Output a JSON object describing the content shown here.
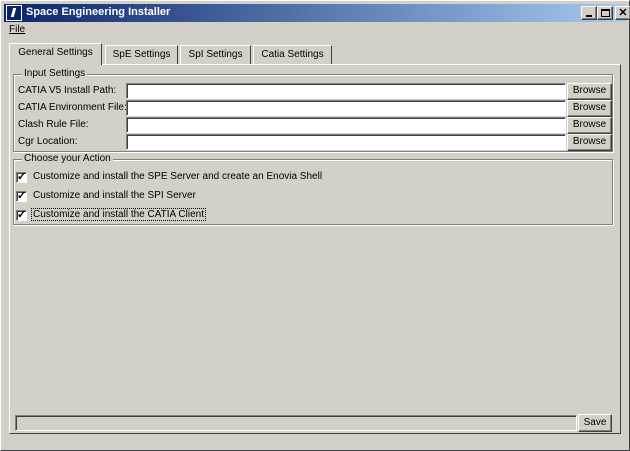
{
  "window": {
    "title": "Space Engineering Installer",
    "controls": {
      "minimize": "_",
      "maximize": "□",
      "close": "✕"
    }
  },
  "menu": {
    "file_label": "File"
  },
  "tabs": [
    {
      "label": "General  Settings",
      "active": true
    },
    {
      "label": "SpE Settings",
      "active": false
    },
    {
      "label": "SpI Settings",
      "active": false
    },
    {
      "label": "Catia Settings",
      "active": false
    }
  ],
  "input_settings": {
    "legend": "Input Settings",
    "fields": [
      {
        "label": "CATIA V5 Install Path:",
        "value": "",
        "button": "Browse"
      },
      {
        "label": "CATIA Environment File:",
        "value": "",
        "button": "Browse"
      },
      {
        "label": "Clash Rule File:",
        "value": "",
        "button": "Browse"
      },
      {
        "label": "Cgr Location:",
        "value": "",
        "button": "Browse"
      }
    ]
  },
  "actions": {
    "legend": "Choose your Action",
    "options": [
      {
        "label": "Customize and install the SPE Server and create an Enovia Shell",
        "checked": true
      },
      {
        "label": "Customize and install the SPI Server",
        "checked": true
      },
      {
        "label": "Customize and install the CATIA Client",
        "checked": true
      }
    ],
    "check_glyph": "✓"
  },
  "footer": {
    "status_text": "",
    "save_label": "Save"
  }
}
